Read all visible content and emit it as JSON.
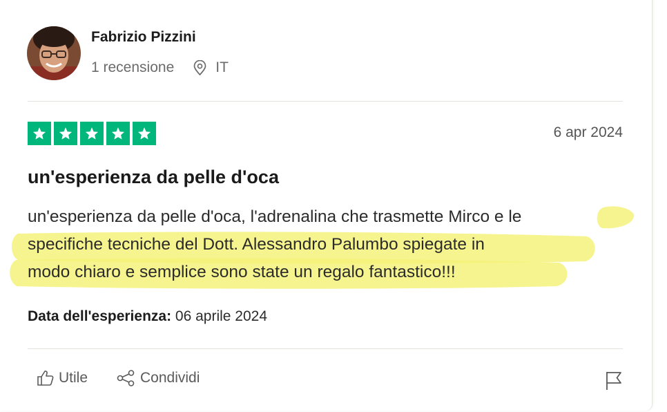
{
  "reviewer": {
    "name": "Fabrizio Pizzini",
    "review_count": "1 recensione",
    "country": "IT"
  },
  "review": {
    "rating": 5,
    "rating_color": "#00b67a",
    "date": "6 apr 2024",
    "title": "un'esperienza da pelle d'oca",
    "body_lines": [
      "un'esperienza da pelle d'oca, l'adrenalina che trasmette Mirco e le",
      "specifiche tecniche del Dott. Alessandro Palumbo spiegate in",
      "modo chiaro e semplice sono state un regalo fantastico!!!"
    ],
    "highlight_color": "#f5f27a",
    "experience_label": "Data dell'esperienza:",
    "experience_date": "06 aprile 2024"
  },
  "actions": {
    "useful_label": "Utile",
    "share_label": "Condividi"
  },
  "icons": {
    "location": "location-pin-icon",
    "useful": "thumbs-up-icon",
    "share": "share-icon",
    "report": "flag-icon"
  }
}
